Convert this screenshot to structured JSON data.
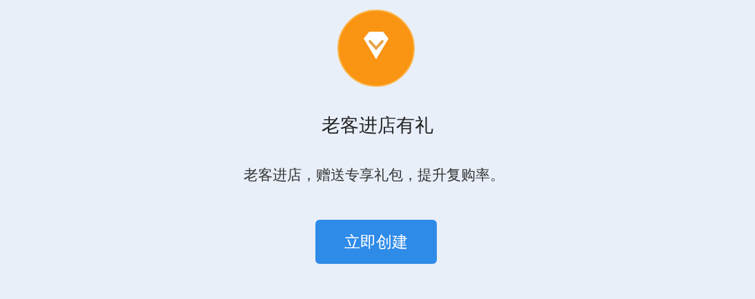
{
  "card": {
    "title": "老客进店有礼",
    "description": "老客进店，赠送专享礼包，提升复购率。",
    "button": "立即创建"
  }
}
